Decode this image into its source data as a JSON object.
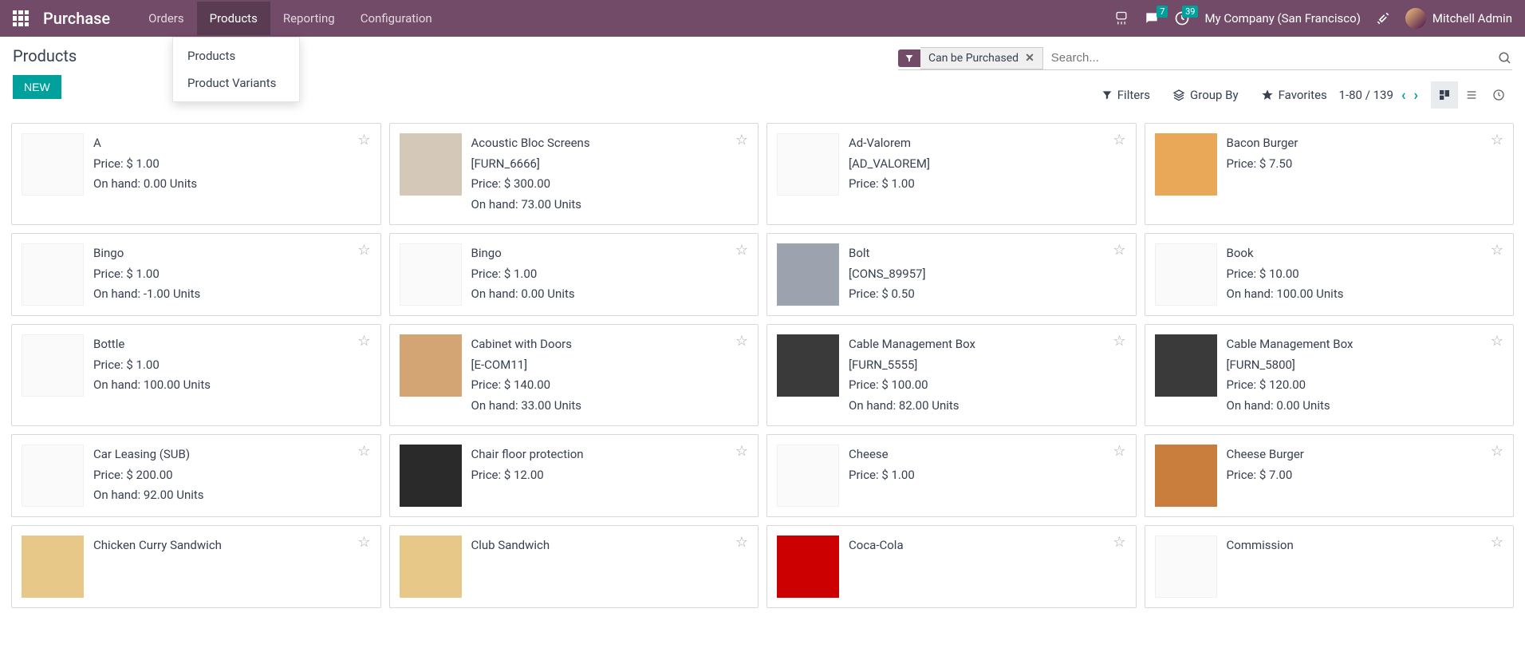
{
  "navbar": {
    "app": "Purchase",
    "items": [
      "Orders",
      "Products",
      "Reporting",
      "Configuration"
    ],
    "active_index": 1,
    "messages_badge": "7",
    "activities_badge": "39",
    "company": "My Company (San Francisco)",
    "user": "Mitchell Admin"
  },
  "dropdown": {
    "items": [
      "Products",
      "Product Variants"
    ]
  },
  "breadcrumb": "Products",
  "buttons": {
    "new": "NEW"
  },
  "search": {
    "facet_label": "Can be Purchased",
    "placeholder": "Search..."
  },
  "options": {
    "filters": "Filters",
    "groupby": "Group By",
    "favorites": "Favorites"
  },
  "pager": {
    "range": "1-80",
    "total": "139"
  },
  "labels": {
    "price": "Price:",
    "onhand": "On hand:",
    "units": "Units"
  },
  "products": [
    {
      "name": "A",
      "ref": null,
      "price": "$ 1.00",
      "onhand": "0.00",
      "img": "placeholder"
    },
    {
      "name": "Acoustic Bloc Screens",
      "ref": "[FURN_6666]",
      "price": "$ 300.00",
      "onhand": "73.00",
      "img": "screen"
    },
    {
      "name": "Ad-Valorem",
      "ref": "[AD_VALOREM]",
      "price": "$ 1.00",
      "onhand": null,
      "img": "placeholder"
    },
    {
      "name": "Bacon Burger",
      "ref": null,
      "price": "$ 7.50",
      "onhand": null,
      "img": "burger1"
    },
    {
      "name": "Bingo",
      "ref": null,
      "price": "$ 1.00",
      "onhand": "-1.00",
      "img": "placeholder"
    },
    {
      "name": "Bingo",
      "ref": null,
      "price": "$ 1.00",
      "onhand": "0.00",
      "img": "placeholder"
    },
    {
      "name": "Bolt",
      "ref": "[CONS_89957]",
      "price": "$ 0.50",
      "onhand": null,
      "img": "bolt"
    },
    {
      "name": "Book",
      "ref": null,
      "price": "$ 10.00",
      "onhand": "100.00",
      "img": "placeholder"
    },
    {
      "name": "Bottle",
      "ref": null,
      "price": "$ 1.00",
      "onhand": "100.00",
      "img": "placeholder"
    },
    {
      "name": "Cabinet with Doors",
      "ref": "[E-COM11]",
      "price": "$ 140.00",
      "onhand": "33.00",
      "img": "cabinet"
    },
    {
      "name": "Cable Management Box",
      "ref": "[FURN_5555]",
      "price": "$ 100.00",
      "onhand": "82.00",
      "img": "box"
    },
    {
      "name": "Cable Management Box",
      "ref": "[FURN_5800]",
      "price": "$ 120.00",
      "onhand": "0.00",
      "img": "box"
    },
    {
      "name": "Car Leasing (SUB)",
      "ref": null,
      "price": "$ 200.00",
      "onhand": "92.00",
      "img": "placeholder"
    },
    {
      "name": "Chair floor protection",
      "ref": null,
      "price": "$ 12.00",
      "onhand": null,
      "img": "mat"
    },
    {
      "name": "Cheese",
      "ref": null,
      "price": "$ 1.00",
      "onhand": null,
      "img": "placeholder"
    },
    {
      "name": "Cheese Burger",
      "ref": null,
      "price": "$ 7.00",
      "onhand": null,
      "img": "burger2"
    },
    {
      "name": "Chicken Curry Sandwich",
      "ref": null,
      "price": null,
      "onhand": null,
      "img": "sandwich"
    },
    {
      "name": "Club Sandwich",
      "ref": null,
      "price": null,
      "onhand": null,
      "img": "sandwich"
    },
    {
      "name": "Coca-Cola",
      "ref": null,
      "price": null,
      "onhand": null,
      "img": "coke"
    },
    {
      "name": "Commission",
      "ref": null,
      "price": null,
      "onhand": null,
      "img": "placeholder"
    }
  ]
}
